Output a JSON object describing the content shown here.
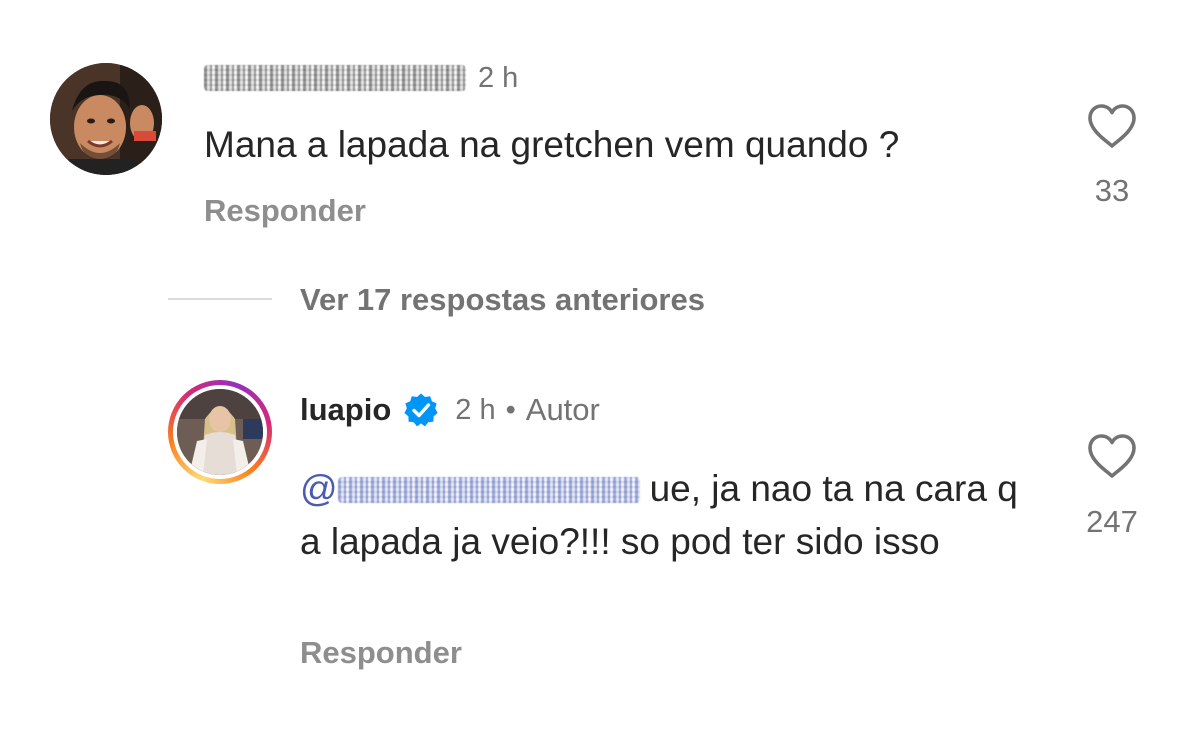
{
  "comment1": {
    "time": "2 h",
    "text": "Mana a lapada na gretchen vem quando ?",
    "reply_label": "Responder",
    "likes": "33",
    "avatar_icon": "profile-photo-man"
  },
  "view_replies": {
    "label": "Ver 17 respostas anteriores"
  },
  "comment2": {
    "username": "luapio",
    "verified_icon": "verified-badge-icon",
    "time": "2 h",
    "separator": "•",
    "author_tag": "Autor",
    "mention_prefix": "@",
    "text": "ue, ja nao ta na cara q a lapada ja veio?!!! so pod ter sido isso",
    "reply_label": "Responder",
    "likes": "247",
    "avatar_icon": "profile-photo-woman"
  },
  "colors": {
    "text": "#262626",
    "muted": "#737373",
    "reply": "#8e8e8e",
    "mention": "#4a5bb0",
    "verified": "#0095f6"
  }
}
